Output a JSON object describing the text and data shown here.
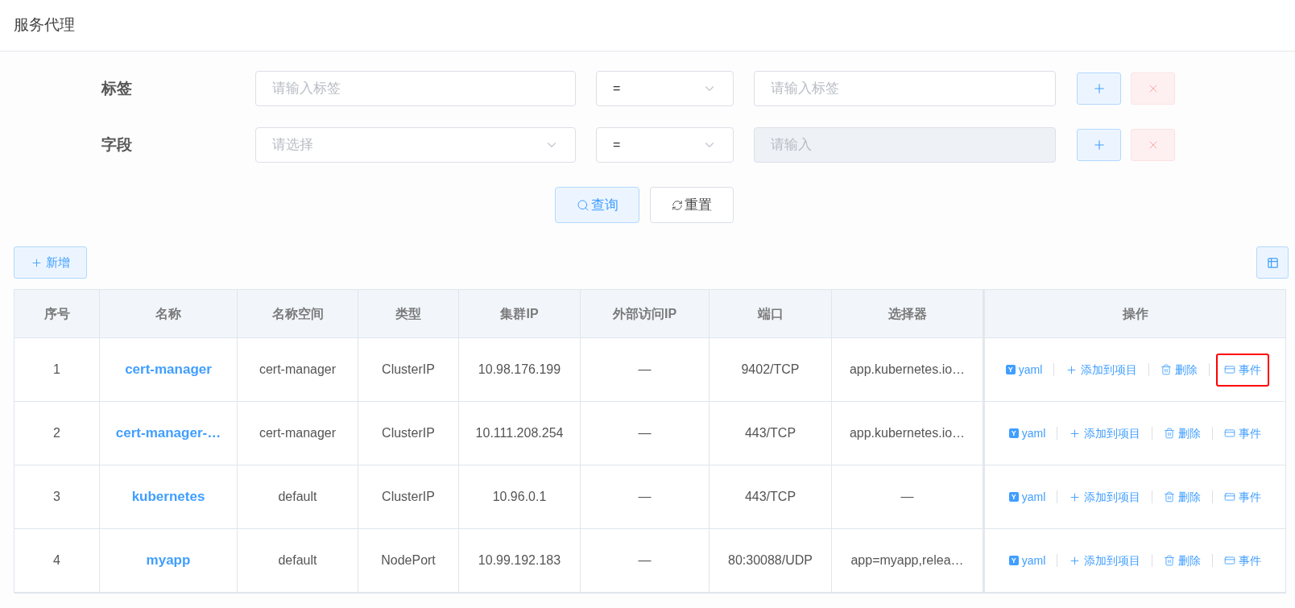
{
  "page_title": "服务代理",
  "filters": [
    {
      "label": "标签",
      "key_field": {
        "kind": "input",
        "placeholder": "请输入标签"
      },
      "operator": {
        "value": "="
      },
      "value_field": {
        "placeholder": "请输入标签",
        "disabled": false
      },
      "add_disabled": false,
      "remove_disabled": true
    },
    {
      "label": "字段",
      "key_field": {
        "kind": "select",
        "placeholder": "请选择"
      },
      "operator": {
        "value": "="
      },
      "value_field": {
        "placeholder": "请输入",
        "disabled": true
      },
      "add_disabled": false,
      "remove_disabled": true
    }
  ],
  "search_button": "查询",
  "reset_button": "重置",
  "add_button": "新增",
  "table": {
    "columns": [
      "序号",
      "名称",
      "名称空间",
      "类型",
      "集群IP",
      "外部访问IP",
      "端口",
      "选择器",
      "操作"
    ],
    "rows": [
      {
        "index": "1",
        "name": "cert-manager",
        "namespace": "cert-manager",
        "type": "ClusterIP",
        "cluster_ip": "10.98.176.199",
        "external_ip": "—",
        "port": "9402/TCP",
        "selector": "app.kubernetes.io…",
        "actions": [
          {
            "kind": "yaml",
            "badge": "Y",
            "label": "yaml",
            "highlighted": false
          },
          {
            "kind": "add",
            "label": "添加到项目",
            "highlighted": false
          },
          {
            "kind": "delete",
            "label": "删除",
            "highlighted": false
          },
          {
            "kind": "events",
            "label": "事件",
            "highlighted": true
          }
        ]
      },
      {
        "index": "2",
        "name": "cert-manager-…",
        "namespace": "cert-manager",
        "type": "ClusterIP",
        "cluster_ip": "10.111.208.254",
        "external_ip": "—",
        "port": "443/TCP",
        "selector": "app.kubernetes.io…",
        "actions": [
          {
            "kind": "yaml",
            "badge": "Y",
            "label": "yaml",
            "highlighted": false
          },
          {
            "kind": "add",
            "label": "添加到项目",
            "highlighted": false
          },
          {
            "kind": "delete",
            "label": "删除",
            "highlighted": false
          },
          {
            "kind": "events",
            "label": "事件",
            "highlighted": false
          }
        ]
      },
      {
        "index": "3",
        "name": "kubernetes",
        "namespace": "default",
        "type": "ClusterIP",
        "cluster_ip": "10.96.0.1",
        "external_ip": "—",
        "port": "443/TCP",
        "selector": "—",
        "actions": [
          {
            "kind": "yaml",
            "badge": "Y",
            "label": "yaml",
            "highlighted": false
          },
          {
            "kind": "add",
            "label": "添加到项目",
            "highlighted": false
          },
          {
            "kind": "delete",
            "label": "删除",
            "highlighted": false
          },
          {
            "kind": "events",
            "label": "事件",
            "highlighted": false
          }
        ]
      },
      {
        "index": "4",
        "name": "myapp",
        "namespace": "default",
        "type": "NodePort",
        "cluster_ip": "10.99.192.183",
        "external_ip": "—",
        "port": "80:30088/UDP",
        "selector": "app=myapp,relea…",
        "actions": [
          {
            "kind": "yaml",
            "badge": "Y",
            "label": "yaml",
            "highlighted": false
          },
          {
            "kind": "add",
            "label": "添加到项目",
            "highlighted": false
          },
          {
            "kind": "delete",
            "label": "删除",
            "highlighted": false
          },
          {
            "kind": "events",
            "label": "事件",
            "highlighted": false
          }
        ]
      }
    ]
  }
}
